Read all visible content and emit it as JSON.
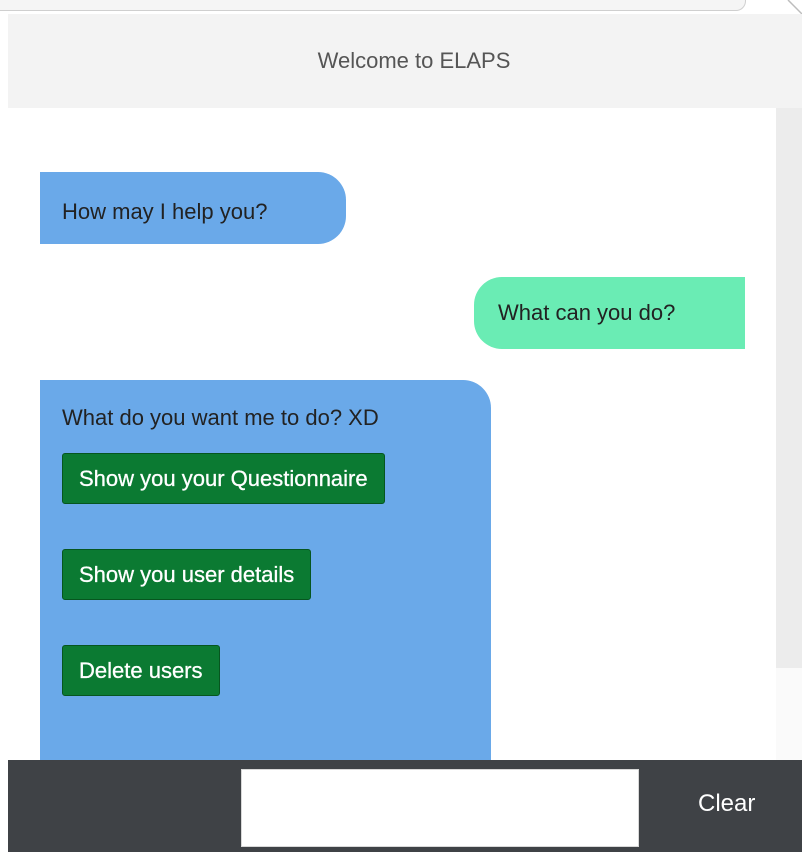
{
  "header": {
    "title": "Welcome to ELAPS"
  },
  "messages": [
    {
      "sender": "bot",
      "text": "How may I help you?"
    },
    {
      "sender": "user",
      "text": "What can you do?"
    },
    {
      "sender": "bot",
      "text": "What do you want me to do? XD",
      "buttons": [
        "Show you your Questionnaire",
        "Show you user details",
        "Delete users"
      ]
    }
  ],
  "footer": {
    "input_value": "",
    "clear_label": "Clear"
  },
  "colors": {
    "bot_bubble": "#6aa9e9",
    "user_bubble": "#6aecb4",
    "action_button": "#0b7a32",
    "footer_bg": "#3f4246",
    "header_bg": "#f3f3f3"
  }
}
